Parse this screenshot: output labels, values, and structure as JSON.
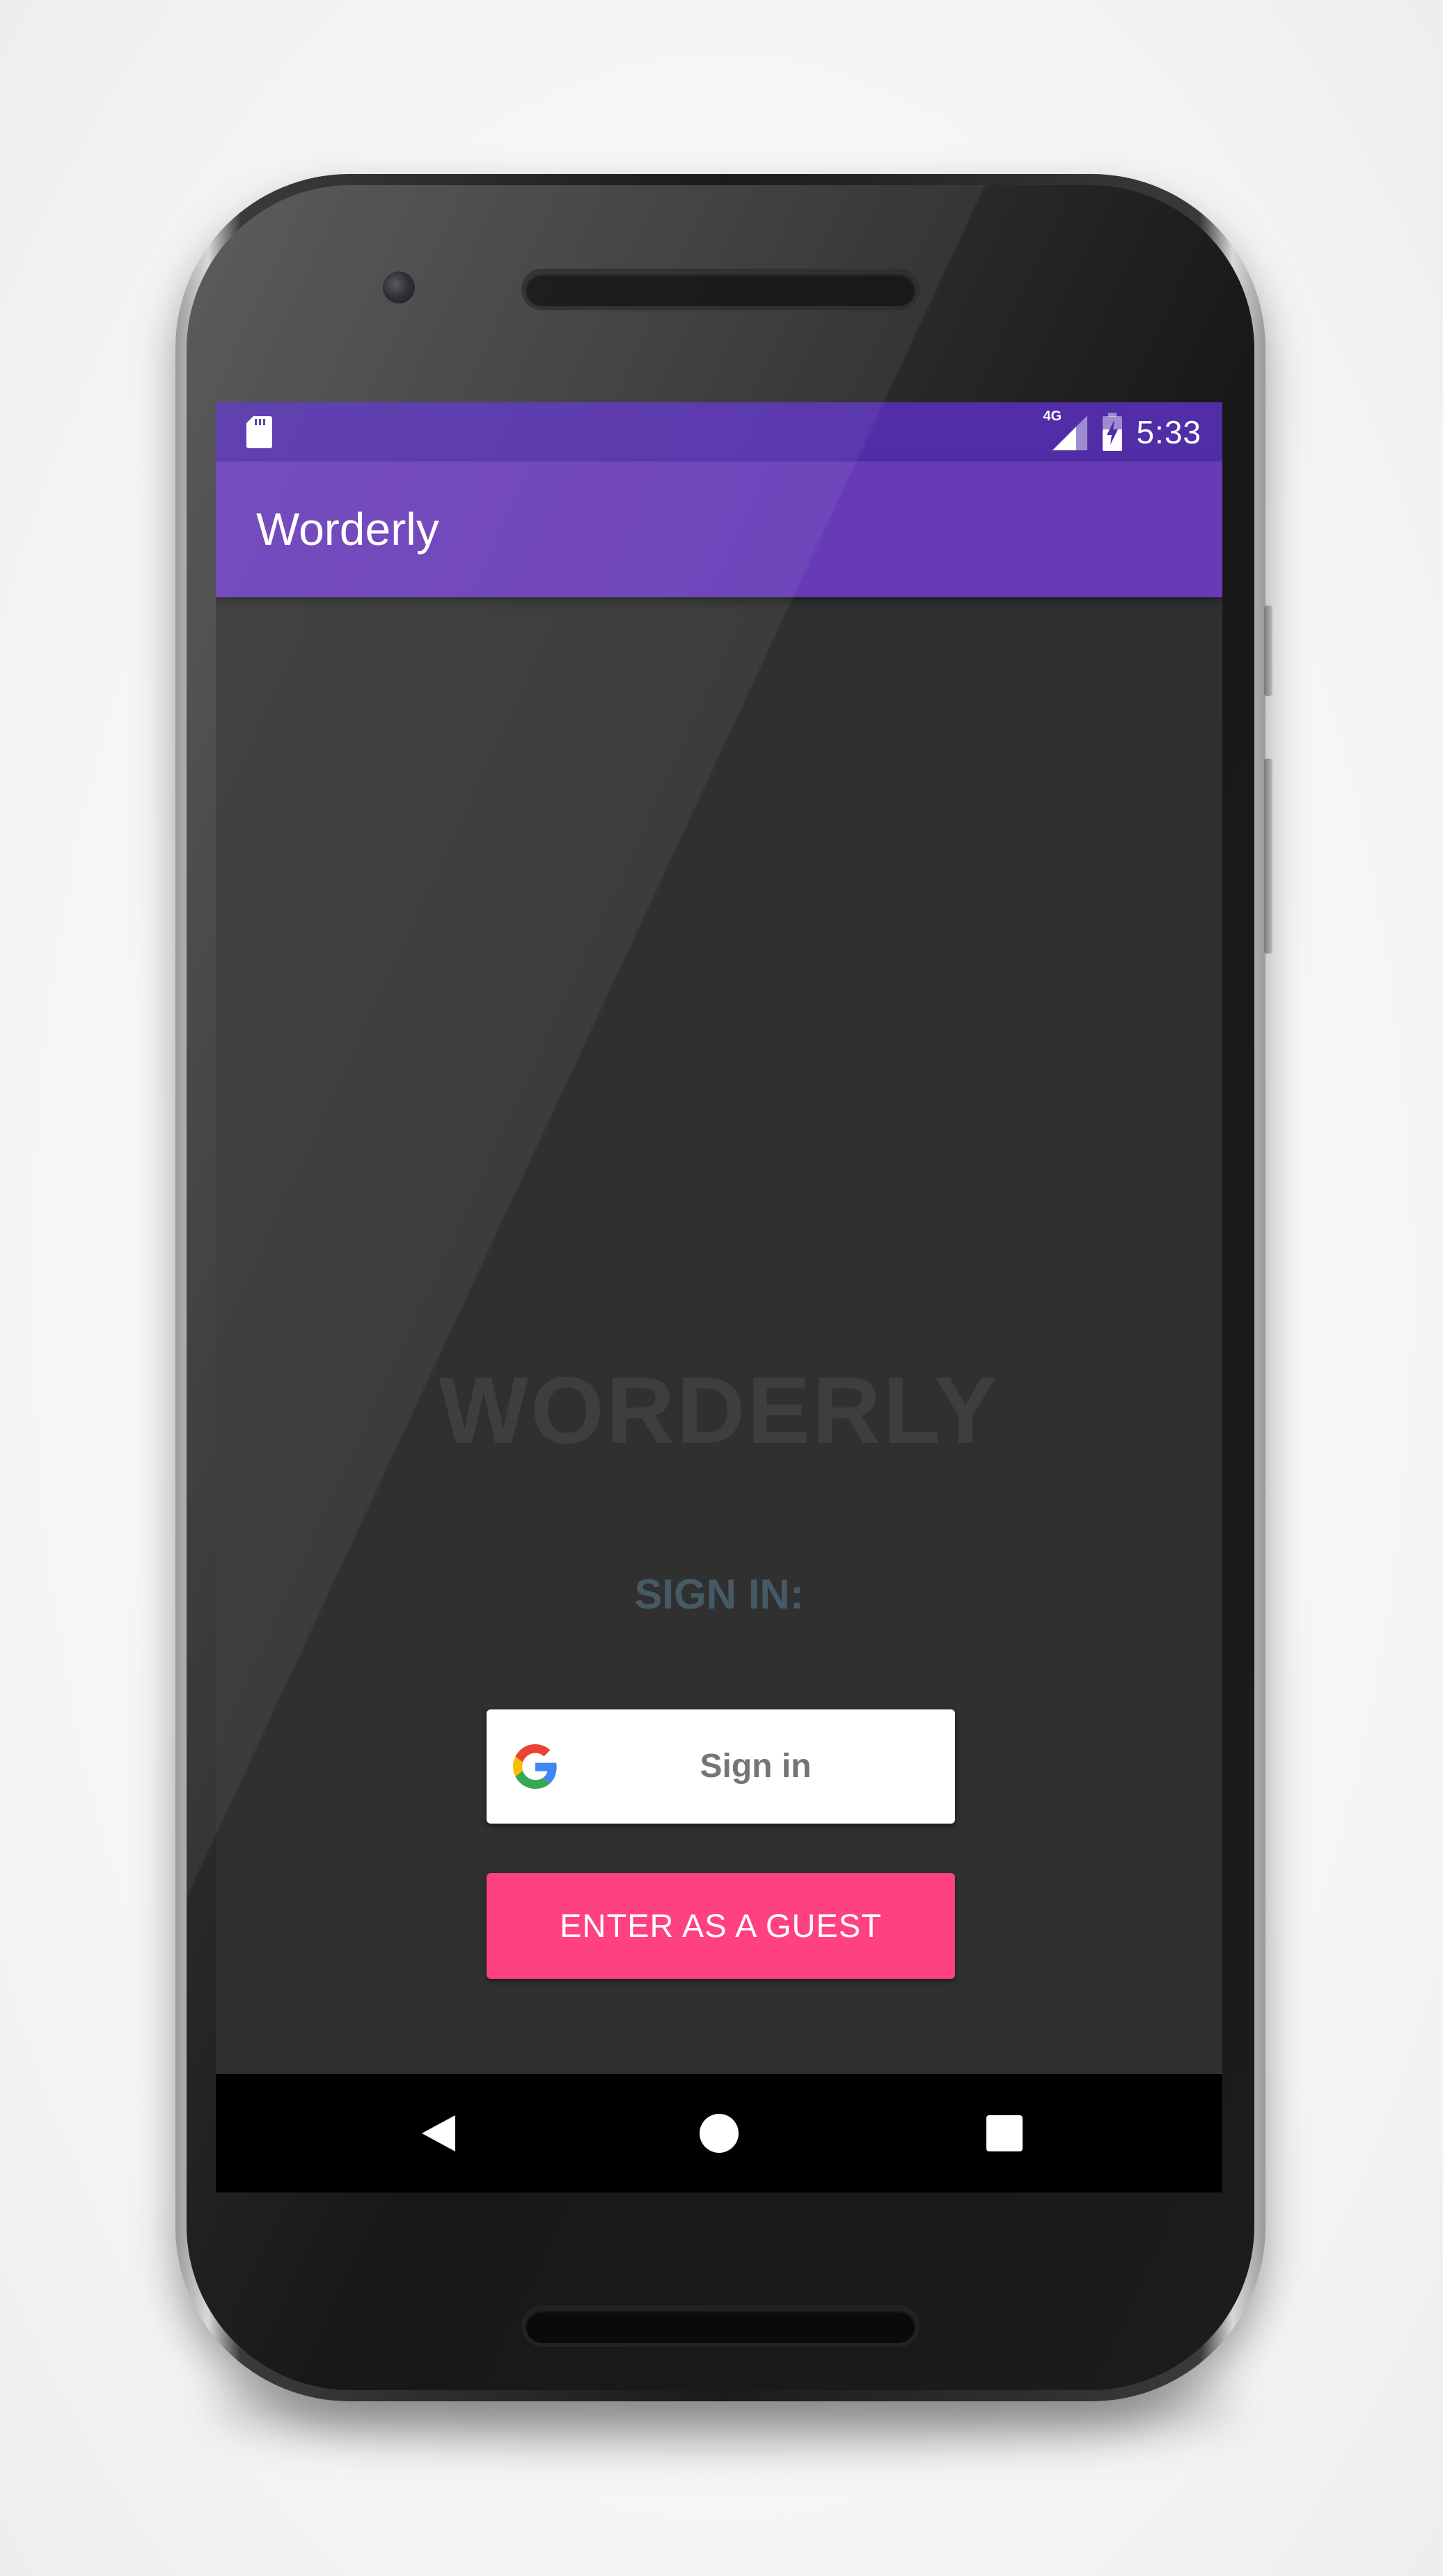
{
  "status_bar": {
    "time": "5:33",
    "network_label": "4G",
    "background": "#512da8",
    "icons": [
      "sd-card-icon",
      "signal-icon",
      "battery-icon"
    ]
  },
  "app_bar": {
    "title": "Worderly",
    "background": "#673ab7"
  },
  "main": {
    "logo_text": "WORDERLY",
    "sign_in_label": "SIGN IN:",
    "google_button": {
      "label": "Sign in",
      "icon": "google-icon"
    },
    "guest_button": {
      "label": "ENTER AS A GUEST",
      "background": "#ff4081"
    },
    "background": "#303030"
  },
  "nav_bar": {
    "buttons": [
      "back",
      "home",
      "recent-apps"
    ]
  }
}
